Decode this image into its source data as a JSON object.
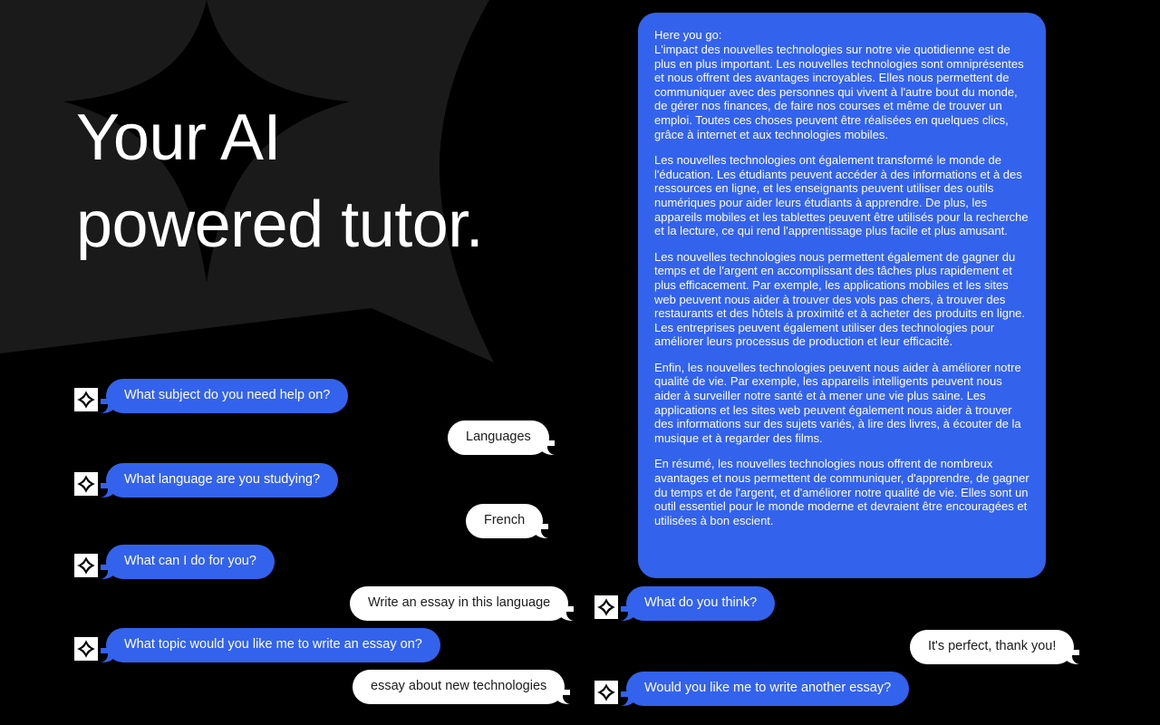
{
  "theme": {
    "background": "#000000",
    "shape_gray": "#1a1a1a",
    "accent_blue": "#3362ec",
    "bubble_user_bg": "#ffffff",
    "bubble_user_text": "#1c1c1c",
    "text_white": "#ffffff"
  },
  "hero": {
    "line1": "Your AI",
    "line2": "powered tutor."
  },
  "conversation_left": [
    {
      "sender": "bot",
      "text": "What subject do you need help on?"
    },
    {
      "sender": "user",
      "text": "Languages"
    },
    {
      "sender": "bot",
      "text": "What language are you studying?"
    },
    {
      "sender": "user",
      "text": "French"
    },
    {
      "sender": "bot",
      "text": "What can I do for you?"
    },
    {
      "sender": "user",
      "text": "Write an essay in this language"
    },
    {
      "sender": "bot",
      "text": "What topic would you like me to write an essay on?"
    },
    {
      "sender": "user",
      "text": "essay about new technologies"
    }
  ],
  "conversation_right": [
    {
      "sender": "bot",
      "text": "What do you think?"
    },
    {
      "sender": "user",
      "text": "It's perfect, thank you!"
    },
    {
      "sender": "bot",
      "text": "Would you like me to write another essay?"
    }
  ],
  "essay": {
    "lead": "Here you go:",
    "paragraphs": [
      "L'impact des nouvelles technologies sur notre vie quotidienne est de plus en plus important. Les nouvelles technologies sont omniprésentes et nous offrent des avantages incroyables. Elles nous permettent de communiquer avec des personnes qui vivent à l'autre bout du monde, de gérer nos finances, de faire nos courses et même de trouver un emploi. Toutes ces choses peuvent être réalisées en quelques clics, grâce à internet et aux technologies mobiles.",
      "Les nouvelles technologies ont également transformé le monde de l'éducation. Les étudiants peuvent accéder à des informations et à des ressources en ligne, et les enseignants peuvent utiliser des outils numériques pour aider leurs étudiants à apprendre. De plus, les appareils mobiles et les tablettes peuvent être utilisés pour la recherche et la lecture, ce qui rend l'apprentissage plus facile et plus amusant.",
      "Les nouvelles technologies nous permettent également de gagner du temps et de l'argent en accomplissant des tâches plus rapidement et plus efficacement. Par exemple, les applications mobiles et les sites web peuvent nous aider à trouver des vols pas chers, à trouver des restaurants et des hôtels à proximité et à acheter des produits en ligne. Les entreprises peuvent également utiliser des technologies pour améliorer leurs processus de production et leur efficacité.",
      "Enfin, les nouvelles technologies peuvent nous aider à améliorer notre qualité de vie. Par exemple, les appareils intelligents peuvent nous aider à surveiller notre santé et à mener une vie plus saine. Les applications et les sites web peuvent également nous aider à trouver des informations sur des sujets variés, à lire des livres, à écouter de la musique et à regarder des films.",
      "En résumé, les nouvelles technologies nous offrent de nombreux avantages et nous permettent de communiquer, d'apprendre, de gagner du temps et de l'argent, et d'améliorer notre qualité de vie. Elles sont un outil essentiel pour le monde moderne et devraient être encouragées et utilisées à bon escient."
    ]
  },
  "icons": {
    "avatar": "sparkle-star-icon"
  }
}
